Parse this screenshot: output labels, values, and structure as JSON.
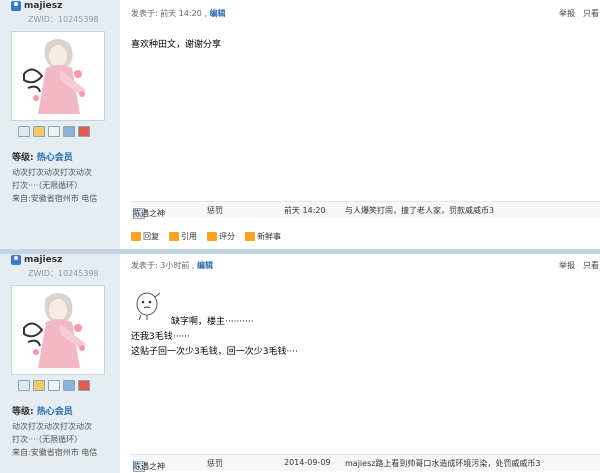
{
  "posts": [
    {
      "username": "majiesz",
      "uid": "ZWID：10245398",
      "level_label": "等级:",
      "level_value": "热心会员",
      "motto_line1": "动次打次动次打次动次",
      "motto_line2": "打次····（无限循环）",
      "from": "来自:安徽省宿州市 电信",
      "posted_at": "发表于: 前天 14:20",
      "edit_label": "编辑",
      "report_label": "举报",
      "only_label": "只看",
      "content_lines": [
        "喜欢种田文，谢谢分享"
      ],
      "rating": {
        "user": "陈遇之神",
        "action": "惩罚",
        "time": "前天 14:20",
        "reason": "与人爆笑打闹，撞了老人家，罚款威威币3"
      }
    },
    {
      "username": "majiesz",
      "uid": "ZWID：10245398",
      "level_label": "等级:",
      "level_value": "热心会员",
      "motto_line1": "动次打次动次打次动次",
      "motto_line2": "打次····（无限循环）",
      "from": "来自:安徽省宿州市 电信",
      "posted_at": "发表于: 3小时前",
      "edit_label": "编辑",
      "report_label": "举报",
      "only_label": "只看",
      "content_lines": [
        "缺字啊，楼主··········",
        "还我3毛钱······",
        "这贴子回一次少3毛钱，回一次少3毛钱····"
      ],
      "rating": {
        "user": "陈遇之神",
        "action": "惩罚",
        "time": "2014-09-09",
        "reason": "majiesz路上看到帅哥口水造成环境污染，处罚威威币3"
      }
    }
  ],
  "actions": {
    "reply": "回复",
    "quote": "引用",
    "rate": "评分",
    "fresh": "新鲜事"
  },
  "icons": [
    "user-icon",
    "message-icon",
    "friend-icon",
    "profile-icon",
    "album-icon",
    "stats-icon",
    "rate-icon",
    "reply-icon",
    "quote-icon",
    "score-icon",
    "fresh-icon",
    "emoji-icon"
  ],
  "colors": {
    "sidebar": "#e5edf2",
    "separator": "#c2d5e3",
    "link": "#2a6bb2",
    "action_icon": "#f6a326"
  }
}
